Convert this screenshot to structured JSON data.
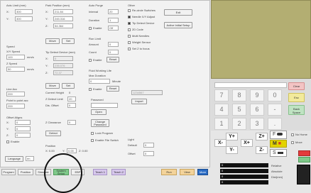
{
  "col1": {
    "axis_limit_label": "Axis Limit (mm)",
    "x_label": "X:",
    "x_value": "300",
    "y_label": "Y:",
    "y_value": "300",
    "speed_label": "Speed",
    "xy_speed_label": "X/Y Speed",
    "xy_speed_value": "100",
    "xy_speed_unit": "mm/s",
    "z_speed_label": "Z Speed",
    "z_speed_value": "50",
    "z_speed_unit": "mm/s",
    "line_acc_label": "Line Acc",
    "line_acc_value": "200",
    "point_acc_label": "Point to point acc",
    "point_acc_value": "200",
    "offset_label": "Offset Aligns",
    "ox_label": "X:",
    "ox_value": "0",
    "oy_label": "Y:",
    "oy_value": "0",
    "oz_label": "Z:",
    "oz_value": "0",
    "enable_label": "Enable",
    "language_label": "Language",
    "language_value": "en"
  },
  "col2": {
    "park_label": "Park Position (mm)",
    "px_label": "X:",
    "px_value": "211.84",
    "py_label": "Y:",
    "py_value": "245.316",
    "pz_label": "Z:",
    "pz_value": "54.364",
    "move_label": "Move",
    "set_label": "Set",
    "tip_label": "Tip Detect Device (mm)",
    "tx_label": "X:",
    "tx_value": "0",
    "ty_label": "Y:",
    "ty_value": "235.076",
    "tz_label": "Z:",
    "tz_value": "72.37",
    "move2_label": "Move",
    "set2_label": "Set",
    "current_height_label": "Current Height",
    "current_height_value": "0",
    "z_detect_label": "Z Detect Limit",
    "z_detect_value": "20",
    "dist_offset_label": "Dis. Offset",
    "dist_offset_value": "0",
    "z_clearance_label": "Z Clearance",
    "z_clearance_value": "0",
    "detect_label": "Detect",
    "position_label": "Position",
    "pos_x_label": "X: 0.00",
    "pos_y_label": "Y:",
    "pos_y_value": "0.00",
    "pos_z_label": "Z: 0.00"
  },
  "col3": {
    "auto_purge_label": "Auto Purge",
    "interval_label": "Interval",
    "interval_value": "20",
    "duration_label": "Duration",
    "duration_value": "1",
    "enable_label": "Enable",
    "enable_value": "Off",
    "run_limit_label": "Run Limit",
    "amount_label": "Amount",
    "amount_value": "0",
    "count_label": "Count",
    "count_value": "0",
    "enable2_label": "Enable",
    "reset_label": "Reset",
    "fluid_life_label": "Fluid Working Life",
    "max_duration_label": "Max Duration",
    "max_duration_value": "0",
    "minute_label": "Minute",
    "enable3_label": "Enable",
    "reset2_label": "Reset",
    "password_label": "Password",
    "open_label": "Open",
    "change_password_label": "Change Password",
    "lock_program_label": "Lock Program",
    "enable_file_switch_label": "Enable File Switch"
  },
  "col4": {
    "other_label": "Other",
    "re_circle_label": "Re-circle Switches",
    "needle_xy_label": "Needle X/Y Adjust",
    "tip_detect_label": "Tip Detect Device",
    "sd_code_label": "2D Code",
    "multi_needles_label": "Multi Needles",
    "weight_sensor_label": "Weight Sensor",
    "set_z_focus_label": "Set Z to focus",
    "exit_label": "Exit",
    "active_initial_label": "Active Initial Setup",
    "device_label": "1234567",
    "import_label": "Import",
    "light_label": "Light",
    "default_label": "Default",
    "default_value": "0",
    "offset_label": "Offset",
    "offset_value": "0"
  },
  "keypad": {
    "keys": [
      "7",
      "8",
      "9",
      "0",
      "4",
      "5",
      "6",
      "-",
      "1",
      "2",
      "3",
      "."
    ],
    "clear_label": "Clear",
    "esc_label": "Esc",
    "back_space_label": "Back Space"
  },
  "jog": {
    "x_minus": "X-",
    "x_plus": "X+",
    "y_plus": "Y+",
    "y_minus": "Y-",
    "z_plus": "Z+",
    "z_minus": "Z-",
    "f_label": "F",
    "m_label": "M",
    "s_label": "S",
    "no_home_label": "No Home",
    "move_label": "Move",
    "rel_label": "Relative",
    "abs_label": "Absolute",
    "dis_label": "Dist(mm)"
  },
  "tabs": {
    "program_label": "Program",
    "position_label": "Position",
    "simulate_label": "Simulate",
    "system_setup_label": "System Setup",
    "ebp_label": "EBP",
    "teach_1_label": "Teach 1",
    "teach_2_label": "Teach 2",
    "run_label": "Run",
    "view_label": "View",
    "more_label": "More"
  },
  "status": {
    "x_value": "0",
    "y_value": "0",
    "z_value": "0",
    "w_value": "0"
  },
  "colors": {
    "accent_red": "#e33b3b",
    "accent_yellow": "#e3d300",
    "accent_green": "#7fc98a",
    "camera_bg": "#b3ae72"
  }
}
